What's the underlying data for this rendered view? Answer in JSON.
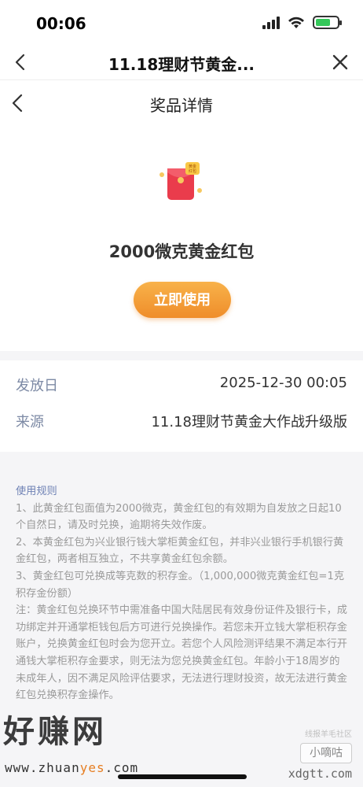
{
  "status_bar": {
    "time": "00:06",
    "icons": [
      "signal-icon",
      "wifi-icon",
      "battery-charging-icon"
    ],
    "battery_color": "#34c759"
  },
  "webview": {
    "title": "11.18理财节黄金...",
    "back_icon": "chevron-left-icon",
    "close_icon": "close-icon"
  },
  "page_header": {
    "title": "奖品详情",
    "back_icon": "chevron-left-icon"
  },
  "prize": {
    "icon": "red-envelope-icon",
    "icon_label": "黄金红包",
    "name": "2000微克黄金红包",
    "button_label": "立即使用",
    "button_color": "#f0922c"
  },
  "info": [
    {
      "label": "发放日",
      "value": "2025-12-30 00:05"
    },
    {
      "label": "来源",
      "value": "11.18理财节黄金大作战升级版"
    }
  ],
  "rules": {
    "title": "使用规则",
    "items": [
      "1、此黄金红包面值为2000微克，黄金红包的有效期为自发放之日起10个自然日，请及时兑换，逾期将失效作废。",
      "2、本黄金红包为兴业银行钱大掌柜黄金红包，并非兴业银行手机银行黄金红包，两者相互独立，不共享黄金红包余额。",
      "3、黄金红包可兑换成等克数的积存金。（1,000,000微克黄金红包=1克积存金份额）",
      "注：黄金红包兑换环节中需准备中国大陆居民有效身份证件及银行卡，成功绑定并开通掌柜钱包后方可进行兑换操作。若您未开立钱大掌柜积存金账户，兑换黄金红包时会为您开立。若您个人风险测评结果不满足本行开通钱大掌柜积存金要求，则无法为您兑换黄金红包。年龄小于18周岁的未成年人，因不满足风险评估要求，无法进行理财投资，故无法进行黄金红包兑换积存金操作。"
    ]
  },
  "watermark": {
    "left_text": "好赚网",
    "left_url_prefix": "www.zhuan",
    "left_url_highlight": "yes",
    "left_url_suffix": ".com",
    "right_small": "线报羊毛社区",
    "right_box": "小嘀咕",
    "right_url": "xdgtt.com"
  }
}
